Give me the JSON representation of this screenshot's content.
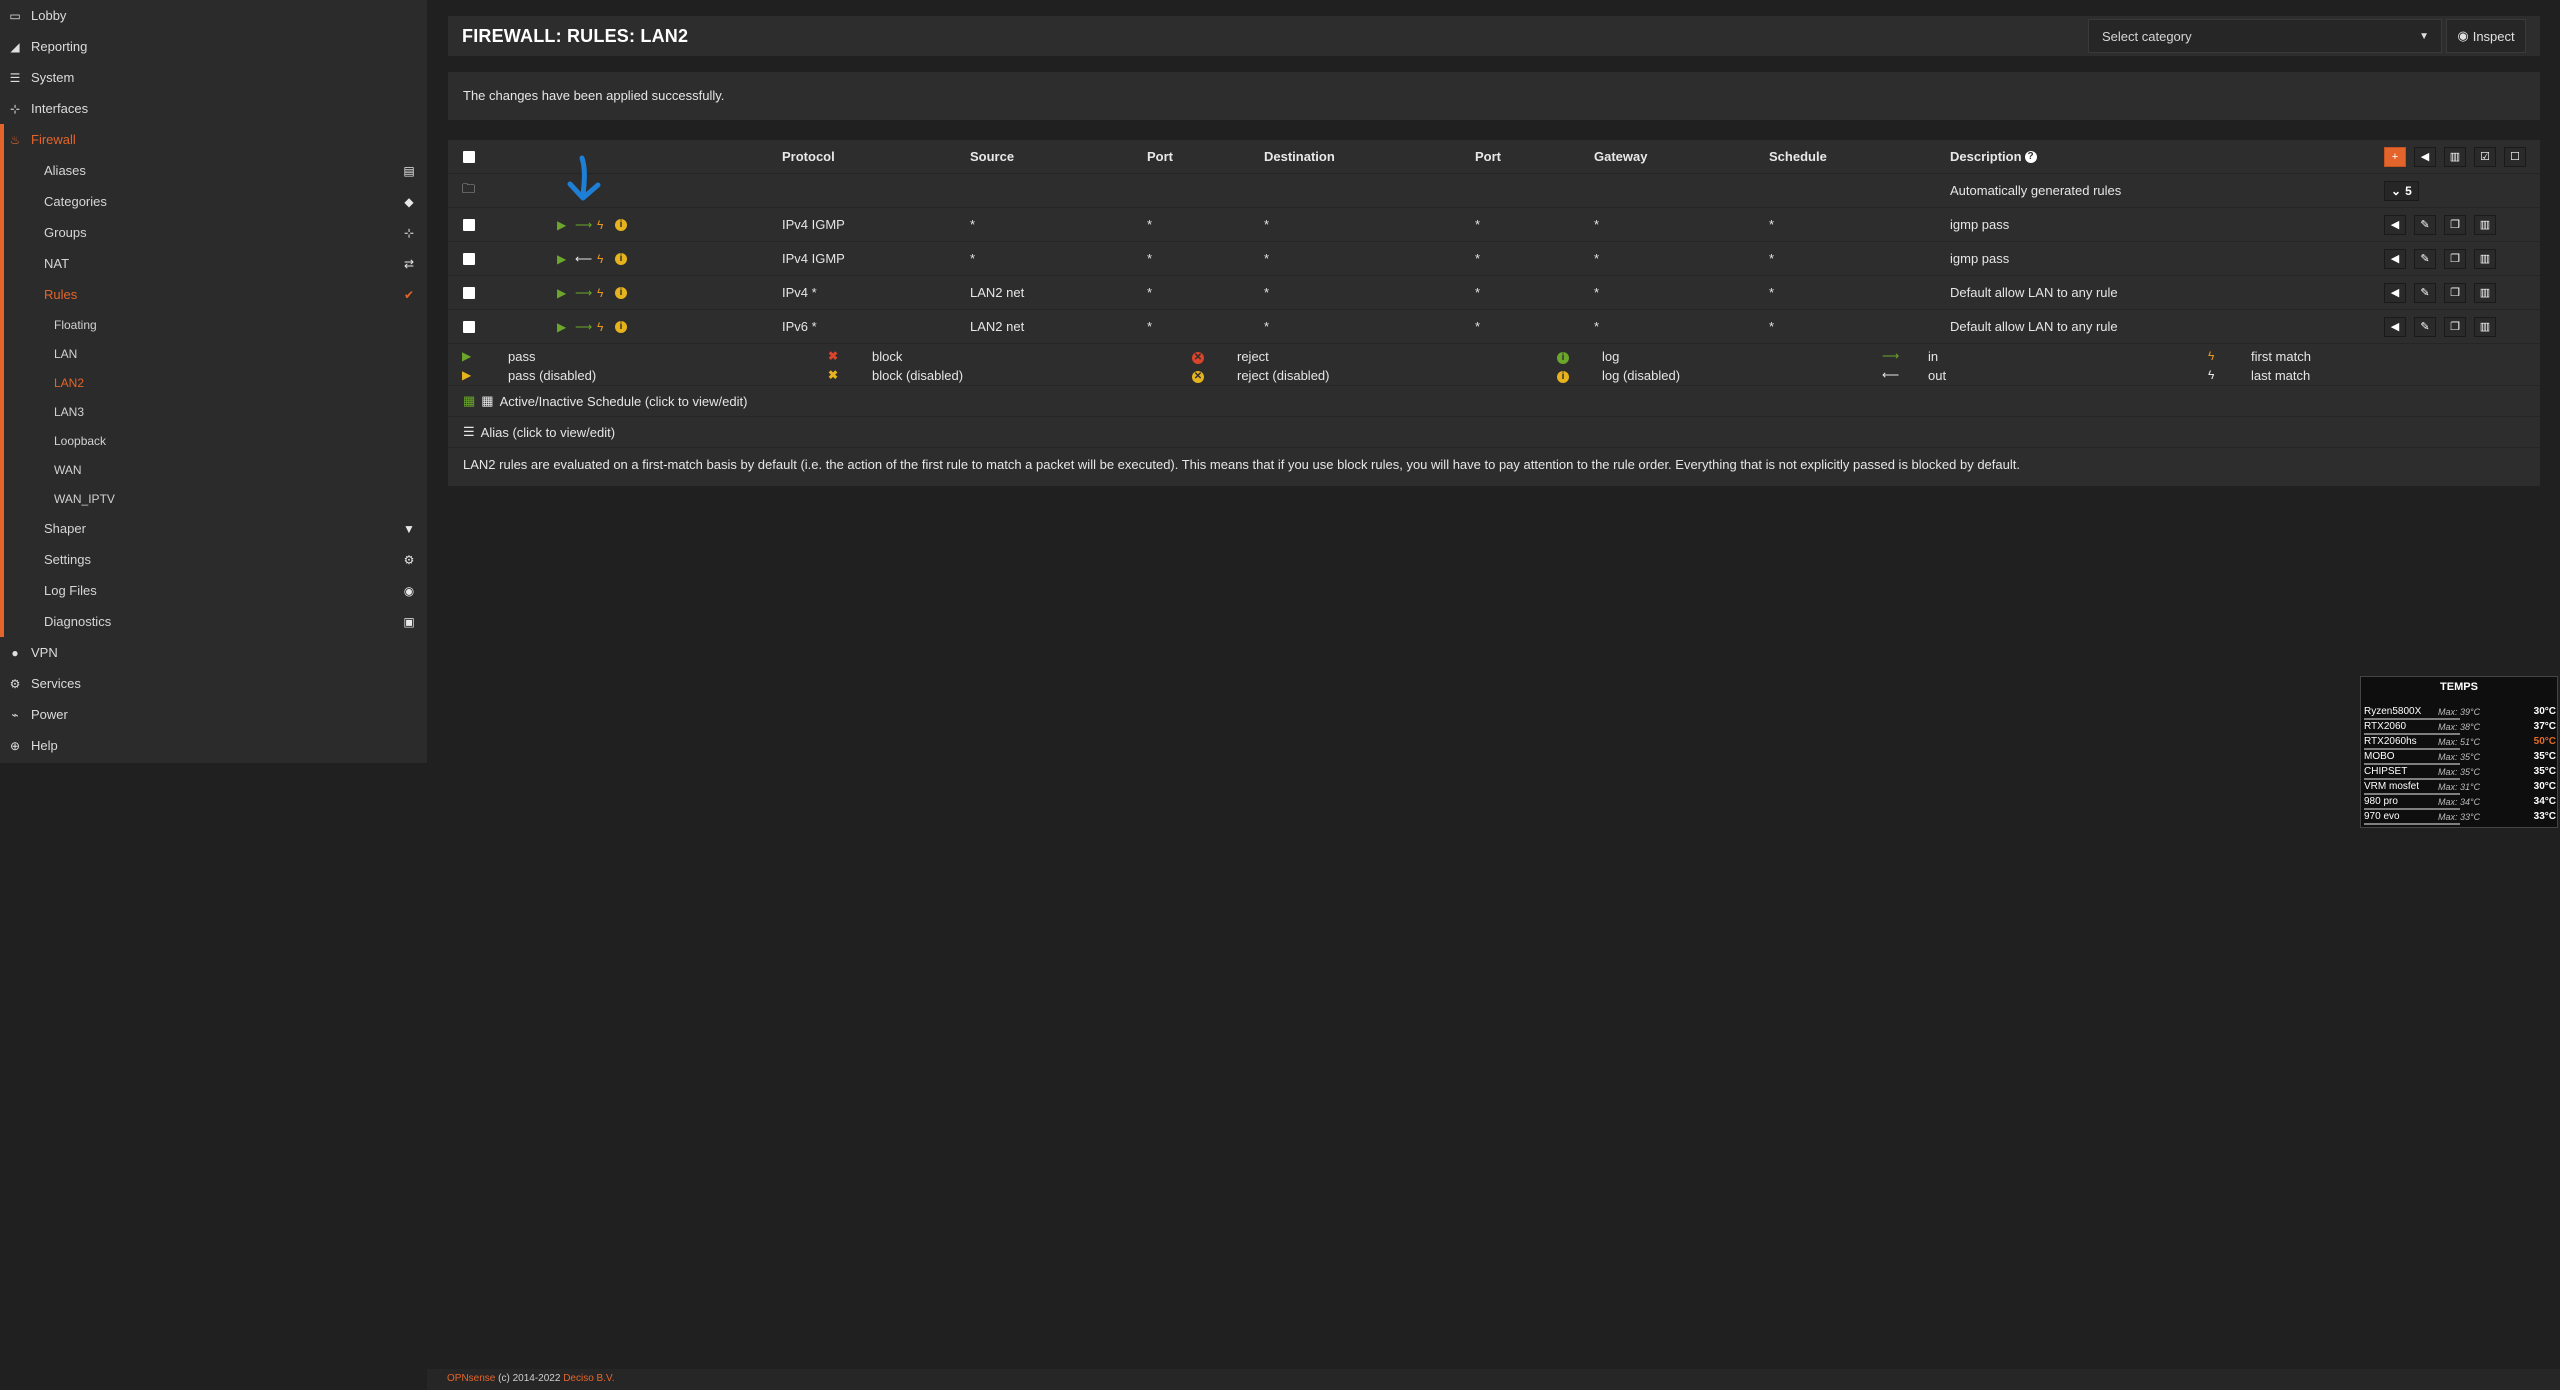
{
  "sidebar": {
    "items": [
      {
        "label": "Lobby",
        "icon": "laptop-icon"
      },
      {
        "label": "Reporting",
        "icon": "area-chart-icon"
      },
      {
        "label": "System",
        "icon": "server-icon"
      },
      {
        "label": "Interfaces",
        "icon": "sitemap-icon"
      },
      {
        "label": "Firewall",
        "icon": "fire-icon"
      }
    ],
    "firewall_children": [
      {
        "label": "Aliases",
        "icon": "list-icon"
      },
      {
        "label": "Categories",
        "icon": "tags-icon"
      },
      {
        "label": "Groups",
        "icon": "sitemap-icon"
      },
      {
        "label": "NAT",
        "icon": "exchange-icon"
      },
      {
        "label": "Rules",
        "icon": "check-icon"
      }
    ],
    "rules_children": [
      "Floating",
      "LAN",
      "LAN2",
      "LAN3",
      "Loopback",
      "WAN",
      "WAN_IPTV"
    ],
    "firewall_children_after": [
      {
        "label": "Shaper",
        "icon": "filter-icon"
      },
      {
        "label": "Settings",
        "icon": "cogs-icon"
      },
      {
        "label": "Log Files",
        "icon": "eye-icon"
      },
      {
        "label": "Diagnostics",
        "icon": "medkit-icon"
      }
    ],
    "items_after": [
      {
        "label": "VPN",
        "icon": "globe-icon"
      },
      {
        "label": "Services",
        "icon": "cog-icon"
      },
      {
        "label": "Power",
        "icon": "plug-icon"
      },
      {
        "label": "Help",
        "icon": "life-ring-icon"
      }
    ]
  },
  "header": {
    "title": "FIREWALL: RULES: LAN2",
    "category_placeholder": "Select category",
    "inspect_label": "Inspect"
  },
  "alert": {
    "message": "The changes have been applied successfully."
  },
  "table": {
    "columns": [
      "Protocol",
      "Source",
      "Port",
      "Destination",
      "Port",
      "Gateway",
      "Schedule",
      "Description"
    ],
    "group_row": {
      "description": "Automatically generated rules",
      "count": "5"
    },
    "rows": [
      {
        "protocol": "IPv4 IGMP",
        "source": "*",
        "src_port": "*",
        "destination": "*",
        "dst_port": "*",
        "gateway": "*",
        "schedule": "*",
        "description": "igmp pass",
        "direction": "in"
      },
      {
        "protocol": "IPv4 IGMP",
        "source": "*",
        "src_port": "*",
        "destination": "*",
        "dst_port": "*",
        "gateway": "*",
        "schedule": "*",
        "description": "igmp pass",
        "direction": "out"
      },
      {
        "protocol": "IPv4 *",
        "source": "LAN2 net",
        "src_port": "*",
        "destination": "*",
        "dst_port": "*",
        "gateway": "*",
        "schedule": "*",
        "description": "Default allow LAN to any rule",
        "direction": "in"
      },
      {
        "protocol": "IPv6 *",
        "source": "LAN2 net",
        "src_port": "*",
        "destination": "*",
        "dst_port": "*",
        "gateway": "*",
        "schedule": "*",
        "description": "Default allow LAN to any rule",
        "direction": "in"
      }
    ]
  },
  "legend": {
    "pass": "pass",
    "pass_disabled": "pass (disabled)",
    "block": "block",
    "block_disabled": "block (disabled)",
    "reject": "reject",
    "reject_disabled": "reject (disabled)",
    "log": "log",
    "log_disabled": "log (disabled)",
    "in": "in",
    "out": "out",
    "first_match": "first match",
    "last_match": "last match",
    "schedule": "Active/Inactive Schedule (click to view/edit)",
    "alias": "Alias (click to view/edit)",
    "note": "LAN2 rules are evaluated on a first-match basis by default (i.e. the action of the first rule to match a packet will be executed). This means that if you use block rules, you will have to pay attention to the rule order. Everything that is not explicitly passed is blocked by default."
  },
  "footer": {
    "brand": "OPNsense",
    "copyright": " (c) 2014-2022 ",
    "company": "Deciso B.V."
  },
  "temps": {
    "title": "TEMPS",
    "rows": [
      {
        "name": "Ryzen5800X",
        "max": "Max: 39°C",
        "value": "30°C",
        "hot": false
      },
      {
        "name": "RTX2060",
        "max": "Max: 38°C",
        "value": "37°C",
        "hot": false
      },
      {
        "name": "RTX2060hs",
        "max": "Max: 51°C",
        "value": "50°C",
        "hot": true
      },
      {
        "name": "MOBO",
        "max": "Max: 35°C",
        "value": "35°C",
        "hot": false
      },
      {
        "name": "CHIPSET",
        "max": "Max: 35°C",
        "value": "35°C",
        "hot": false
      },
      {
        "name": "VRM mosfet",
        "max": "Max: 31°C",
        "value": "30°C",
        "hot": false
      },
      {
        "name": "980 pro",
        "max": "Max: 34°C",
        "value": "34°C",
        "hot": false
      },
      {
        "name": "970 evo",
        "max": "Max: 33°C",
        "value": "33°C",
        "hot": false
      }
    ]
  },
  "colors": {
    "accent": "#e4652b",
    "pass": "#6aa72a",
    "warn": "#e6b31e",
    "block": "#d9442c",
    "annotation": "#1e7fd6"
  }
}
